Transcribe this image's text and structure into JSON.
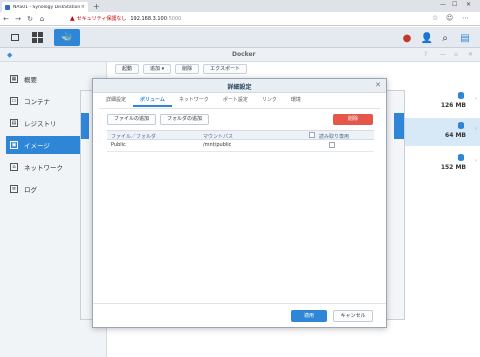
{
  "browser": {
    "tab_title": "NAS01 - Synology DiskStation",
    "tab_close": "×",
    "new_tab": "+",
    "security_text": "セキュリティ保護なし",
    "url_host": "192.168.3.100",
    "url_port": ":5000"
  },
  "docker": {
    "title": "Docker",
    "toolbar": [
      "起動",
      "追加 ▾",
      "削除",
      "エクスポート"
    ],
    "sidebar": [
      {
        "label": "概要",
        "icon": "overview-icon"
      },
      {
        "label": "コンテナ",
        "icon": "container-icon"
      },
      {
        "label": "レジストリ",
        "icon": "registry-icon"
      },
      {
        "label": "イメージ",
        "icon": "image-icon",
        "active": true
      },
      {
        "label": "ネットワーク",
        "icon": "network-icon"
      },
      {
        "label": "ログ",
        "icon": "log-icon"
      }
    ],
    "sizes": [
      "126 MB",
      "64 MB",
      "152 MB"
    ]
  },
  "dialog": {
    "title": "詳細設定",
    "tabs": [
      "詳細設定",
      "ボリューム",
      "ネットワーク",
      "ポート設定",
      "リンク",
      "環境"
    ],
    "active_tab": "ボリューム",
    "add_file": "ファイルの追加",
    "add_folder": "フォルダの追加",
    "delete": "削除",
    "columns": [
      "ファイル／フォルダ",
      "マウントパス",
      "読み取り専用"
    ],
    "rows": [
      {
        "folder": "Public",
        "mount": "/mnt/public",
        "readonly": false
      }
    ],
    "apply": "適用",
    "cancel": "キャンセル"
  },
  "colors": {
    "accent": "#2f86d6",
    "danger": "#e5564b"
  }
}
